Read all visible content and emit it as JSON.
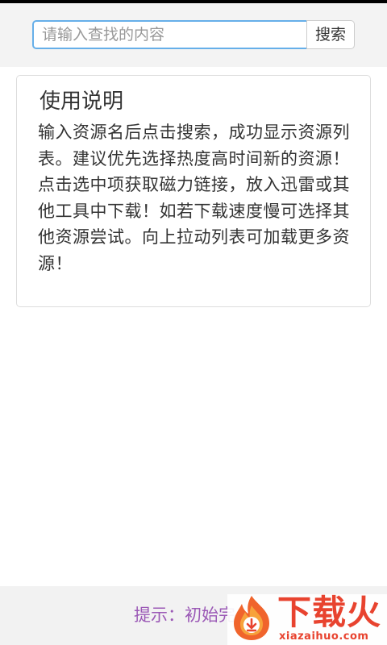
{
  "search": {
    "placeholder": "请输入查找的内容",
    "value": "",
    "button_label": "搜索"
  },
  "panel": {
    "title": "使用说明",
    "body": "输入资源名后点击搜索，成功显示资源列表。建议优先选择热度高时间新的资源！点击选中项获取磁力链接，放入迅雷或其他工具中下载！如若下载速度慢可选择其他资源尝试。向上拉动列表可加载更多资源！"
  },
  "footer": {
    "tip": "提示：初始完"
  },
  "watermark": {
    "title": "下载火",
    "domain": "xiazaihuo.com",
    "icon": "flame-download-icon"
  },
  "colors": {
    "input_focus_border": "#66afe9",
    "footer_tip": "#9b59b6",
    "watermark_brand": "#e8432f"
  }
}
